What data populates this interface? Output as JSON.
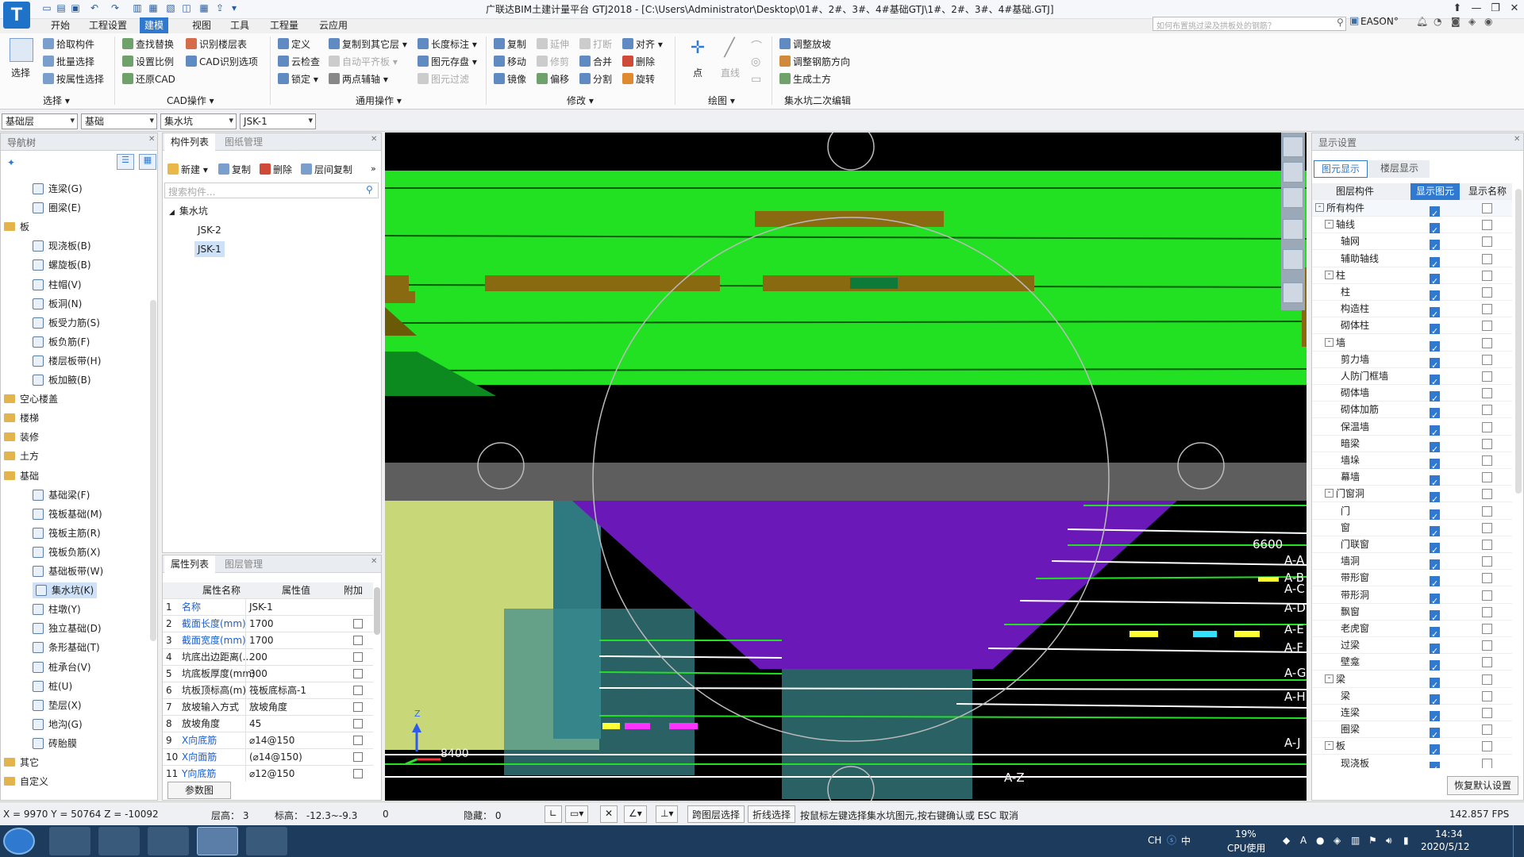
{
  "title": {
    "app_icon": "T",
    "text": "广联达BIM土建计量平台 GTJ2018 - [C:\\Users\\Administrator\\Desktop\\01#、2#、3#、4#基础GTJ\\1#、2#、3#、4#基础.GTJ]",
    "help_placeholder": "如何布置挑过梁及拱板处的钢筋？",
    "user": "EASON°"
  },
  "menu": [
    "开始",
    "工程设置",
    "建模",
    "视图",
    "工具",
    "工程量",
    "云应用"
  ],
  "ribbon": {
    "select": {
      "big": "选择",
      "items": [
        "拾取构件",
        "批量选择",
        "按属性选择"
      ],
      "group": "选择"
    },
    "cad": {
      "items": [
        "查找替换",
        "识别楼层表",
        "设置比例",
        "CAD识别选项",
        "还原CAD"
      ],
      "group": "CAD操作"
    },
    "general": {
      "items": [
        "定义",
        "复制到其它层",
        "长度标注",
        "云检查",
        "自动平齐板",
        "图元存盘",
        "锁定",
        "两点辅轴",
        "图元过滤"
      ],
      "group": "通用操作"
    },
    "modify": {
      "items": [
        "复制",
        "延伸",
        "打断",
        "对齐",
        "移动",
        "修剪",
        "合并",
        "删除",
        "镜像",
        "偏移",
        "分割",
        "旋转"
      ],
      "group": "修改"
    },
    "draw": {
      "items": [
        "点",
        "直线"
      ],
      "group": "绘图"
    },
    "pit": {
      "items": [
        "调整放坡",
        "调整钢筋方向",
        "生成土方"
      ],
      "group": "集水坑二次编辑"
    }
  },
  "selectors": [
    "基础层",
    "基础",
    "集水坑",
    "JSK-1"
  ],
  "nav": {
    "title": "导航树",
    "items": [
      {
        "label": "连梁(G)",
        "type": "child"
      },
      {
        "label": "圈梁(E)",
        "type": "child"
      },
      {
        "label": "板",
        "type": "folder"
      },
      {
        "label": "现浇板(B)",
        "type": "child"
      },
      {
        "label": "螺旋板(B)",
        "type": "child"
      },
      {
        "label": "柱帽(V)",
        "type": "child"
      },
      {
        "label": "板洞(N)",
        "type": "child"
      },
      {
        "label": "板受力筋(S)",
        "type": "child"
      },
      {
        "label": "板负筋(F)",
        "type": "child"
      },
      {
        "label": "楼层板带(H)",
        "type": "child"
      },
      {
        "label": "板加腋(B)",
        "type": "child"
      },
      {
        "label": "空心楼盖",
        "type": "folder"
      },
      {
        "label": "楼梯",
        "type": "folder"
      },
      {
        "label": "装修",
        "type": "folder"
      },
      {
        "label": "土方",
        "type": "folder"
      },
      {
        "label": "基础",
        "type": "folder"
      },
      {
        "label": "基础梁(F)",
        "type": "child"
      },
      {
        "label": "筏板基础(M)",
        "type": "child"
      },
      {
        "label": "筏板主筋(R)",
        "type": "child"
      },
      {
        "label": "筏板负筋(X)",
        "type": "child"
      },
      {
        "label": "基础板带(W)",
        "type": "child"
      },
      {
        "label": "集水坑(K)",
        "type": "child",
        "selected": true
      },
      {
        "label": "柱墩(Y)",
        "type": "child"
      },
      {
        "label": "独立基础(D)",
        "type": "child"
      },
      {
        "label": "条形基础(T)",
        "type": "child"
      },
      {
        "label": "桩承台(V)",
        "type": "child"
      },
      {
        "label": "桩(U)",
        "type": "child"
      },
      {
        "label": "垫层(X)",
        "type": "child"
      },
      {
        "label": "地沟(G)",
        "type": "child"
      },
      {
        "label": "砖胎膜",
        "type": "child"
      },
      {
        "label": "其它",
        "type": "folder"
      },
      {
        "label": "自定义",
        "type": "folder"
      }
    ]
  },
  "components": {
    "tabs": [
      "构件列表",
      "图纸管理"
    ],
    "toolbar": [
      "新建",
      "复制",
      "删除",
      "层间复制"
    ],
    "search_placeholder": "搜索构件...",
    "group": "集水坑",
    "items": [
      "JSK-2",
      "JSK-1"
    ]
  },
  "properties": {
    "tabs": [
      "属性列表",
      "图层管理"
    ],
    "headers": [
      "属性名称",
      "属性值",
      "附加"
    ],
    "rows": [
      {
        "no": "1",
        "name": "名称",
        "value": "JSK-1",
        "blue": true,
        "check": false
      },
      {
        "no": "2",
        "name": "截面长度(mm)",
        "value": "1700",
        "blue": true,
        "check": true
      },
      {
        "no": "3",
        "name": "截面宽度(mm)",
        "value": "1700",
        "blue": true,
        "check": true
      },
      {
        "no": "4",
        "name": "坑底出边距离(...",
        "value": "200",
        "blue": false,
        "check": true
      },
      {
        "no": "5",
        "name": "坑底板厚度(mm)",
        "value": "300",
        "blue": false,
        "check": true
      },
      {
        "no": "6",
        "name": "坑板顶标高(m)",
        "value": "筏板底标高-1",
        "blue": false,
        "check": true
      },
      {
        "no": "7",
        "name": "放坡输入方式",
        "value": "放坡角度",
        "blue": false,
        "check": true
      },
      {
        "no": "8",
        "name": "放坡角度",
        "value": "45",
        "blue": false,
        "check": true
      },
      {
        "no": "9",
        "name": "X向底筋",
        "value": "⌀14@150",
        "blue": true,
        "check": true
      },
      {
        "no": "10",
        "name": "X向面筋",
        "value": "(⌀14@150)",
        "blue": true,
        "check": true
      },
      {
        "no": "11",
        "name": "Y向底筋",
        "value": "⌀12@150",
        "blue": true,
        "check": true
      }
    ],
    "param_button": "参数图"
  },
  "viewport": {
    "labels": [
      "6600",
      "A-A",
      "A-B",
      "A-C",
      "A-D",
      "A-E",
      "A-F",
      "A-G",
      "A-H",
      "A-J",
      "A-Z"
    ],
    "ucs_label": "8400",
    "axis_z": "Z",
    "colors": {
      "slab": "#22e022",
      "beam": "#8a6a10",
      "pit": "#6a18b8",
      "grey": "#5e5e5e",
      "wall": "#c8d878"
    }
  },
  "display": {
    "title": "显示设置",
    "tabs": [
      "图元显示",
      "楼层显示"
    ],
    "headers": [
      "图层构件",
      "显示图元",
      "显示名称"
    ],
    "rows": [
      {
        "label": "所有构件",
        "level": 0,
        "expand": "-",
        "show": true,
        "name": false
      },
      {
        "label": "轴线",
        "level": 1,
        "expand": "-",
        "show": true,
        "name": false
      },
      {
        "label": "轴网",
        "level": 2,
        "show": true,
        "name": false
      },
      {
        "label": "辅助轴线",
        "level": 2,
        "show": true,
        "name": false
      },
      {
        "label": "柱",
        "level": 1,
        "expand": "-",
        "show": true,
        "name": false
      },
      {
        "label": "柱",
        "level": 2,
        "show": true,
        "name": false
      },
      {
        "label": "构造柱",
        "level": 2,
        "show": true,
        "name": false
      },
      {
        "label": "砌体柱",
        "level": 2,
        "show": true,
        "name": false
      },
      {
        "label": "墙",
        "level": 1,
        "expand": "-",
        "show": true,
        "name": false
      },
      {
        "label": "剪力墙",
        "level": 2,
        "show": true,
        "name": false
      },
      {
        "label": "人防门框墙",
        "level": 2,
        "show": true,
        "name": false
      },
      {
        "label": "砌体墙",
        "level": 2,
        "show": true,
        "name": false
      },
      {
        "label": "砌体加筋",
        "level": 2,
        "show": true,
        "name": false
      },
      {
        "label": "保温墙",
        "level": 2,
        "show": true,
        "name": false
      },
      {
        "label": "暗梁",
        "level": 2,
        "show": true,
        "name": false
      },
      {
        "label": "墙垛",
        "level": 2,
        "show": true,
        "name": false
      },
      {
        "label": "幕墙",
        "level": 2,
        "show": true,
        "name": false
      },
      {
        "label": "门窗洞",
        "level": 1,
        "expand": "-",
        "show": true,
        "name": false
      },
      {
        "label": "门",
        "level": 2,
        "show": true,
        "name": false
      },
      {
        "label": "窗",
        "level": 2,
        "show": true,
        "name": false
      },
      {
        "label": "门联窗",
        "level": 2,
        "show": true,
        "name": false
      },
      {
        "label": "墙洞",
        "level": 2,
        "show": true,
        "name": false
      },
      {
        "label": "带形窗",
        "level": 2,
        "show": true,
        "name": false
      },
      {
        "label": "带形洞",
        "level": 2,
        "show": true,
        "name": false
      },
      {
        "label": "飘窗",
        "level": 2,
        "show": true,
        "name": false
      },
      {
        "label": "老虎窗",
        "level": 2,
        "show": true,
        "name": false
      },
      {
        "label": "过梁",
        "level": 2,
        "show": true,
        "name": false
      },
      {
        "label": "壁龛",
        "level": 2,
        "show": true,
        "name": false
      },
      {
        "label": "梁",
        "level": 1,
        "expand": "-",
        "show": true,
        "name": false
      },
      {
        "label": "梁",
        "level": 2,
        "show": true,
        "name": false
      },
      {
        "label": "连梁",
        "level": 2,
        "show": true,
        "name": false
      },
      {
        "label": "圈梁",
        "level": 2,
        "show": true,
        "name": false
      },
      {
        "label": "板",
        "level": 1,
        "expand": "-",
        "show": true,
        "name": false
      },
      {
        "label": "现浇板",
        "level": 2,
        "show": true,
        "name": false
      }
    ],
    "restore_button": "恢复默认设置"
  },
  "status": {
    "coords": "X = 9970 Y = 50764 Z = -10092",
    "floor_height": "层高： 3",
    "elevation": "标高： -12.3~-9.3",
    "zero": "0",
    "hidden": "隐藏： 0",
    "cross_layer": "跨图层选择",
    "polyline": "折线选择",
    "hint": "按鼠标左键选择集水坑图元,按右键确认或 ESC 取消",
    "fps": "142.857 FPS"
  },
  "taskbar": {
    "lang": "CH",
    "ime": "中",
    "cpu_percent": "19%",
    "cpu_label": "CPU使用",
    "time": "14:34",
    "date": "2020/5/12"
  }
}
